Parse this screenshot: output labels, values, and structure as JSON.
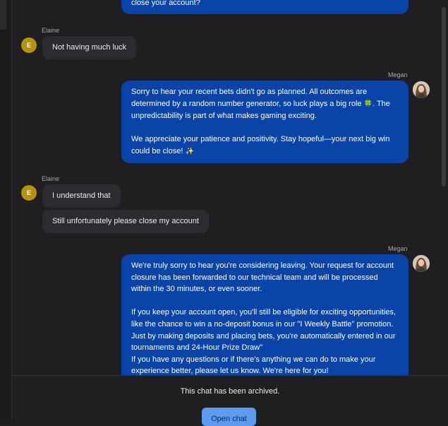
{
  "messages": [
    {
      "type": "agent",
      "text_lines": [
        "close your account?"
      ]
    },
    {
      "type": "customer",
      "sender": "Elaine",
      "initial": "E",
      "texts": [
        "Not having much luck"
      ]
    },
    {
      "type": "agent",
      "sender": "Megan",
      "p1": "Sorry to hear your recent bets didn't go as planned. All outcomes are determined by a random number generator, so luck plays a big role",
      "p1_emoji": "🍀",
      "p1_tail": ". The unpredictability is part of what makes gaming exciting.",
      "p2": "We appreciate your patience and positivity. Stay hopeful—your next big win could be close!",
      "p2_emoji": "✨"
    },
    {
      "type": "customer",
      "sender": "Elaine",
      "initial": "E",
      "texts": [
        "I understand that",
        "Still unfortunately please close my account"
      ]
    },
    {
      "type": "agent",
      "sender": "Megan",
      "p1": "We're truly sorry to hear you're considering leaving. Your request for account closure has been forwarded to our technical team and will be processed within the 30 minutes, or even sooner.",
      "p2": "If you keep your account open, you'll still be eligible for exciting opportunities, like the chance to win a no-deposit bonus in our \"I Weekly Battle\" promotion. Just by making deposits and placing bets, you're automatically entered in our tournaments and 24-Hour Prize Draw\"",
      "p3": "If you have any questions or if there's anything we can do to make your experience better, please let us know. We're here for you!"
    }
  ],
  "footer": {
    "archived_text": "This chat has been archived.",
    "open_chat_label": "Open chat"
  },
  "colors": {
    "agent_bubble": "#0b44a8",
    "customer_bubble": "#2c2c30",
    "avatar_customer": "#b5920f",
    "button": "#5b9bf0"
  }
}
